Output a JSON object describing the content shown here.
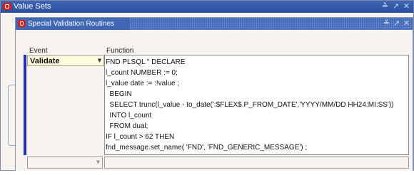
{
  "outer_window": {
    "title": "Value Sets",
    "controls": [
      "≚",
      "↗",
      "✕"
    ]
  },
  "inner_window": {
    "title": "Special Validation Routines",
    "controls": [
      "≚",
      "↗",
      "✕"
    ]
  },
  "columns": {
    "event": "Event",
    "function": "Function"
  },
  "rows": [
    {
      "event": "Validate",
      "function_lines": [
        "FND PLSQL \" DECLARE",
        "l_count NUMBER := 0;",
        "l_value date := :!value ;",
        "  BEGIN",
        "  SELECT trunc(l_value - to_date(':$FLEX$.P_FROM_DATE','YYYY/MM/DD HH24:MI:SS'))",
        "  INTO l_count",
        "  FROM dual;",
        "IF l_count > 62 THEN",
        "fnd_message.set_name( 'FND', 'FND_GENERIC_MESSAGE') ;"
      ]
    },
    {
      "event": "",
      "function_lines": []
    }
  ],
  "icons": {
    "logo": "oracle-logo-icon",
    "dropdown": "chevron-down-icon"
  }
}
